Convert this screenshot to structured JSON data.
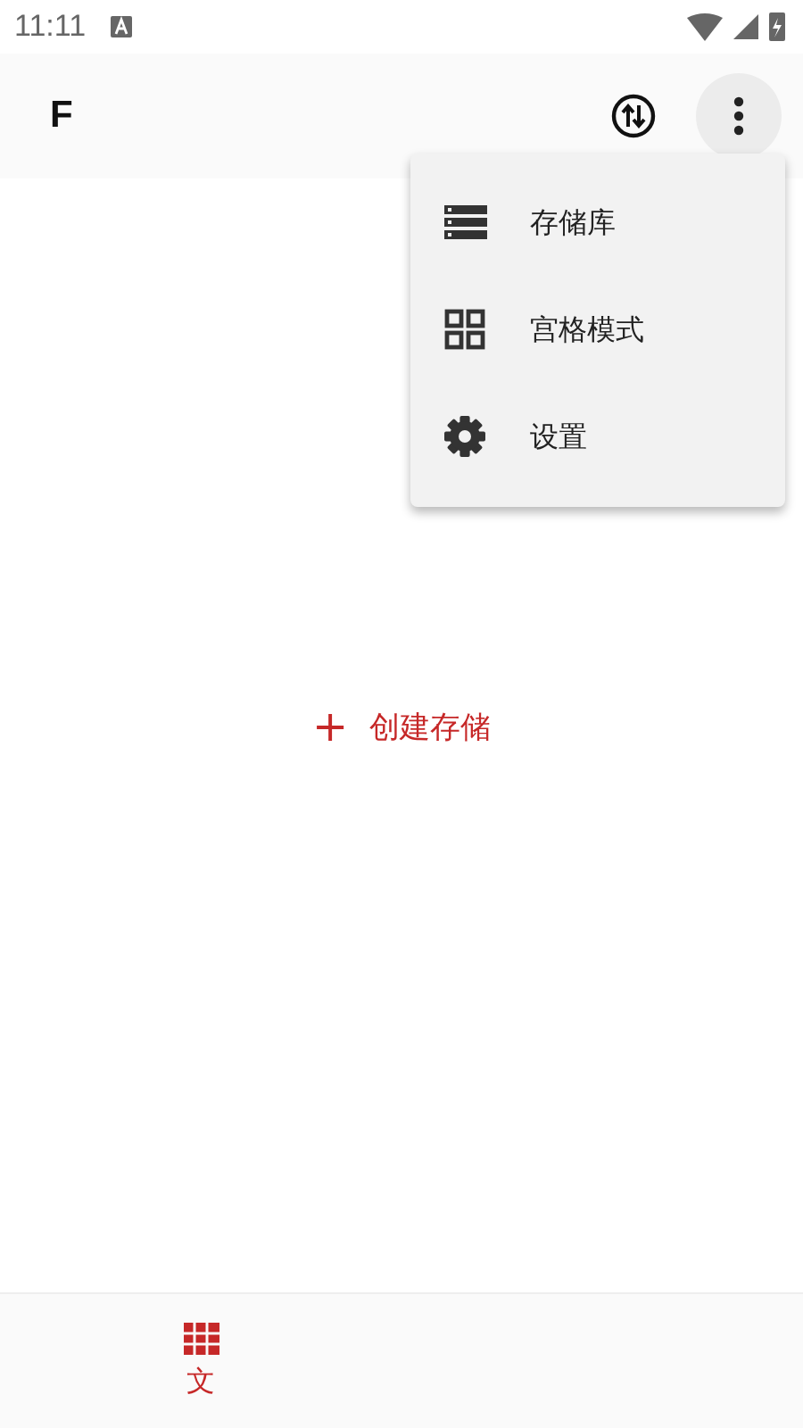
{
  "status_bar": {
    "time": "11:11"
  },
  "app_bar": {
    "title": "F"
  },
  "menu": [
    {
      "label": "存储库"
    },
    {
      "label": "宫格模式"
    },
    {
      "label": "设置"
    }
  ],
  "create_button": {
    "icon": "+",
    "label": "创建存储"
  },
  "bottom_nav": [
    {
      "label": "文",
      "selected": true
    }
  ]
}
